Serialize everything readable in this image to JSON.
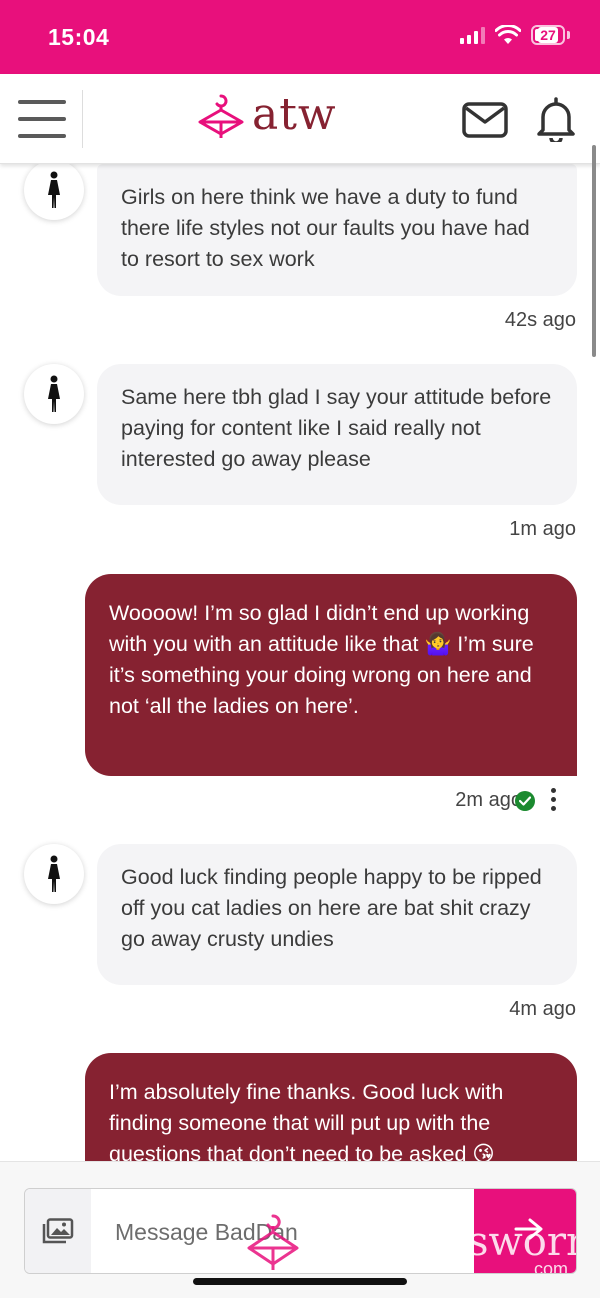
{
  "status_bar": {
    "time": "15:04",
    "battery": "27",
    "color": "#e8107c"
  },
  "header": {
    "logo_text": "atw",
    "brand_color": "#862231"
  },
  "messages": [
    {
      "direction": "incoming",
      "text": "Girls on here think we have a duty to fund there life styles not our faults you have had to resort to sex work",
      "time": "42s ago"
    },
    {
      "direction": "incoming",
      "text": "Same here tbh glad I say your attitude before paying for content like I said really not interested go away please",
      "time": "1m ago"
    },
    {
      "direction": "outgoing",
      "text": "Woooow! I’m so glad I didn’t end up working with you with an attitude like that 🤷‍♀️ I’m sure it’s something your doing wrong on here and not ‘all the ladies on here’.",
      "time": "2m ago"
    },
    {
      "direction": "incoming",
      "text": "Good luck finding people happy to be ripped off you cat ladies on here are bat shit crazy go away crusty undies",
      "time": "4m ago"
    },
    {
      "direction": "outgoing",
      "text": "I’m absolutely fine thanks. Good luck with finding someone that will put up with the questions that don’t need to be asked 😘"
    }
  ],
  "composer": {
    "placeholder": "Message BadDan",
    "watermark": "sworn",
    "watermark_sub": "com"
  },
  "icons": {
    "menu": "hamburger-menu-icon",
    "mail": "envelope-icon",
    "bell": "bell-icon",
    "avatar": "person-silhouette-icon",
    "media": "image-gallery-icon",
    "send": "send-arrow-icon",
    "read": "check-circle-icon",
    "more": "kebab-menu-icon"
  }
}
